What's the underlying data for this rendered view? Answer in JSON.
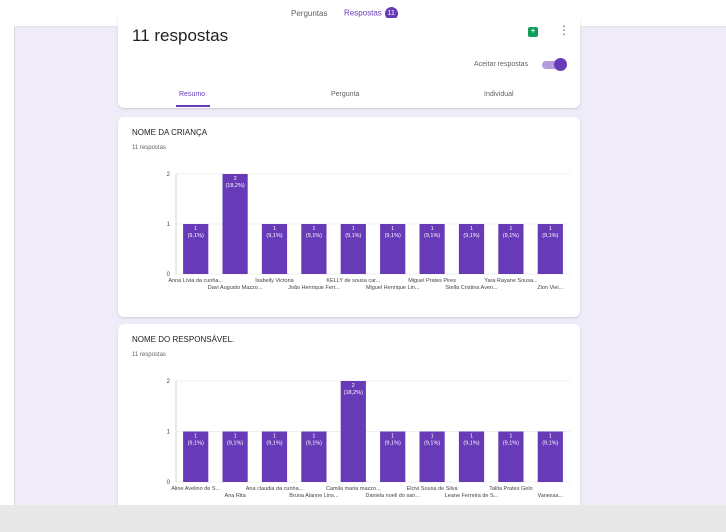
{
  "topbar": {
    "tab_questions": "Perguntas",
    "tab_responses": "Respostas",
    "responses_badge": "11"
  },
  "summary": {
    "title": "11 respostas",
    "sheet_icon": "sheets-icon",
    "more_icon": "more-vert-icon",
    "accept_label": "Aceitar respostas",
    "accept_on": true,
    "subtabs": [
      "Resumo",
      "Pergunta",
      "Individual"
    ]
  },
  "colors": {
    "accent": "#673ab7",
    "bar": "#673ab7",
    "background": "#f0ebf8"
  },
  "chart_data": [
    {
      "type": "bar",
      "title": "NOME DA CRIANÇA",
      "subtitle": "11 respostas",
      "ylim": [
        0,
        2
      ],
      "yticks": [
        0,
        1,
        2
      ],
      "categories": [
        "Anna Lívia da cunha...",
        "Davi Augusto Mazzo...",
        "Isabelly Victoria",
        "João Henrique Ferr...",
        "KELLY de sousa car...",
        "Miguel Henrique Lin...",
        "Miguel Prates Pires",
        "Stella Cristina Aven...",
        "Yara Rayane Sousa...",
        "Zion Viei..."
      ],
      "values": [
        1,
        2,
        1,
        1,
        1,
        1,
        1,
        1,
        1,
        1
      ],
      "labels": [
        "1 (9,1%)",
        "2 (18,2%)",
        "1 (9,1%)",
        "1 (9,1%)",
        "1 (9,1%)",
        "1 (9,1%)",
        "1 (9,1%)",
        "1 (9,1%)",
        "1 (9,1%)",
        "1 (9,1%)"
      ]
    },
    {
      "type": "bar",
      "title": "NOME DO RESPONSÁVEL.",
      "subtitle": "11 respostas",
      "ylim": [
        0,
        2
      ],
      "yticks": [
        0,
        1,
        2
      ],
      "categories": [
        "Aline Avelino de S...",
        "Ana Rita",
        "Ana claudia da cunha...",
        "Bruna Alanne Lins...",
        "Camila maria mazzo...",
        "Daniela noeli do san...",
        "Elcivi Sousa de Silva",
        "Leane Ferreira de S...",
        "Talita Prates Gelo",
        "Vanessa..."
      ],
      "values": [
        1,
        1,
        1,
        1,
        2,
        1,
        1,
        1,
        1,
        1
      ],
      "labels": [
        "1 (9,1%)",
        "1 (9,1%)",
        "1 (9,1%)",
        "1 (9,1%)",
        "2 (18,2%)",
        "1 (9,1%)",
        "1 (9,1%)",
        "1 (9,1%)",
        "1 (9,1%)",
        "1 (9,1%)"
      ]
    }
  ]
}
